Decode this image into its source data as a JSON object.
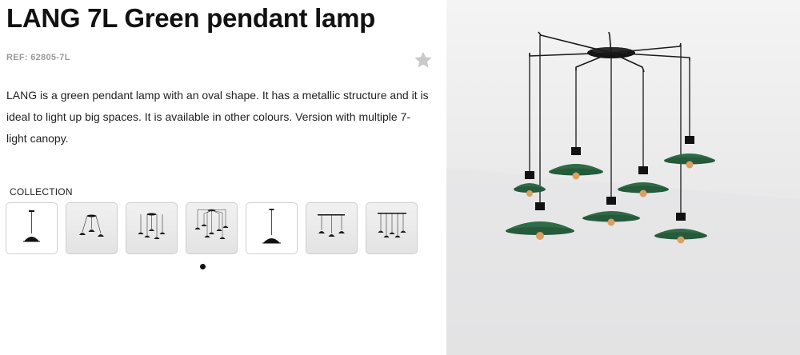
{
  "product": {
    "title": "LANG 7L Green pendant lamp",
    "reference": "REF: 62805-7L",
    "description": "LANG is a green pendant lamp with an oval shape. It has a metallic structure and it is ideal to light up big spaces. It is available in other colours. Version with multiple 7-light canopy.",
    "favorite_icon": "star-icon"
  },
  "collection": {
    "label": "COLLECTION",
    "thumbnails": [
      {
        "variant": "single"
      },
      {
        "variant": "3-light"
      },
      {
        "variant": "5-light"
      },
      {
        "variant": "7-light"
      },
      {
        "variant": "single"
      },
      {
        "variant": "3-light"
      },
      {
        "variant": "5-light"
      }
    ],
    "pagination_pages": 1,
    "active_page": 1
  },
  "colors": {
    "lamp_green": "#2f6b47",
    "title_text": "#111111",
    "ref_text": "#9a9a9a",
    "star_icon": "#c9c9c9"
  }
}
